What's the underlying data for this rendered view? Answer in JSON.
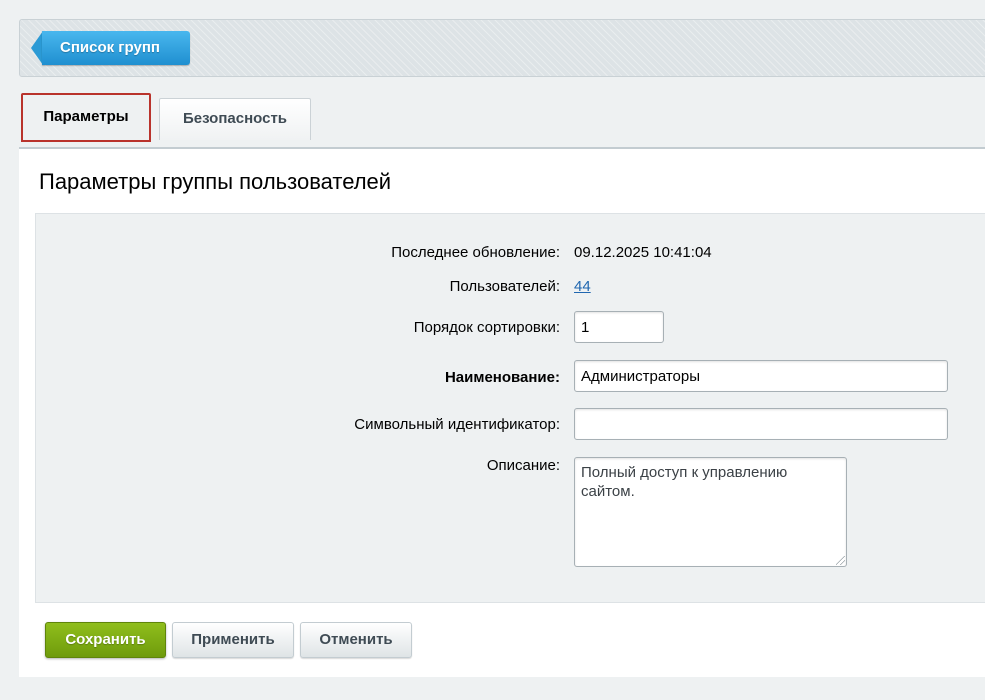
{
  "toolbar": {
    "back_label": "Список групп"
  },
  "tabs": [
    {
      "label": "Параметры",
      "active": true
    },
    {
      "label": "Безопасность",
      "active": false
    }
  ],
  "panel": {
    "title": "Параметры группы пользователей"
  },
  "form": {
    "last_update": {
      "label": "Последнее обновление:",
      "value": "09.12.2025 10:41:04"
    },
    "users": {
      "label": "Пользователей:",
      "value": "44"
    },
    "sort": {
      "label": "Порядок сортировки:",
      "value": "1"
    },
    "name": {
      "label": "Наименование:",
      "value": "Администраторы"
    },
    "string_id": {
      "label": "Символьный идентификатор:",
      "value": ""
    },
    "description": {
      "label": "Описание:",
      "value": "Полный доступ к управлению сайтом."
    }
  },
  "buttons": {
    "save": "Сохранить",
    "apply": "Применить",
    "cancel": "Отменить"
  },
  "colors": {
    "back_button": "#2b9ad5",
    "save_button": "#7fae14",
    "active_tab_border": "#b9332c",
    "link": "#2067b0"
  }
}
